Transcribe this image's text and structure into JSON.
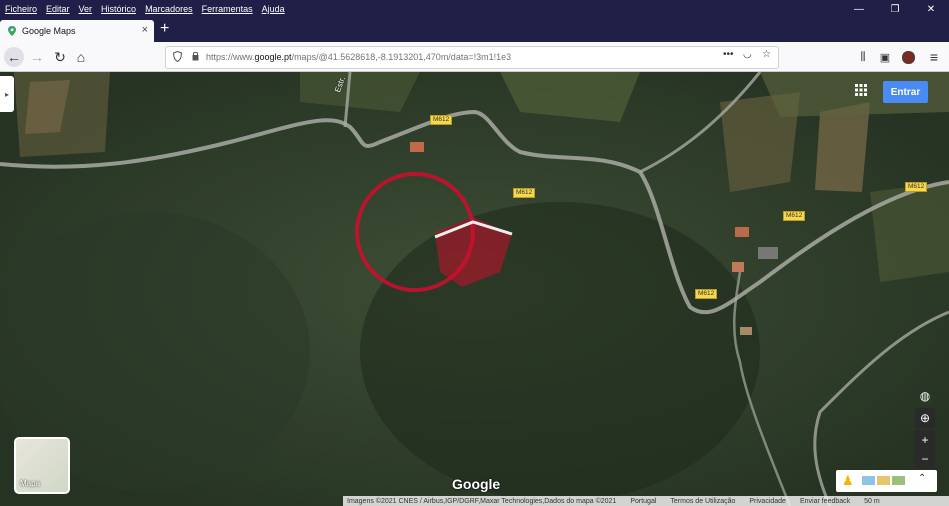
{
  "menu": {
    "items": [
      "Ficheiro",
      "Editar",
      "Ver",
      "Histórico",
      "Marcadores",
      "Ferramentas",
      "Ajuda"
    ]
  },
  "tab": {
    "title": "Google Maps",
    "close": "×",
    "new_tab": "+"
  },
  "url": {
    "prefix": "https://www.",
    "host": "google.pt",
    "path": "/maps/@41.5628618,-8.1913201,470m/data=!3m1!1e3"
  },
  "map": {
    "road_labels": [
      "M612",
      "M612",
      "M612",
      "M612",
      "M612"
    ],
    "street_label": "Estr.",
    "sign_in": "Entrar",
    "layer_thumb_label": "Mapa",
    "logo": "Google",
    "zoom_in": "+",
    "zoom_out": "−",
    "footer": {
      "imagery": "Imagens ©2021 CNES / Airbus,IGP/DGRF,Maxar Technologies,Dados do mapa ©2021",
      "country": "Portugal",
      "terms": "Termos de Utilização",
      "privacy": "Privacidade",
      "feedback": "Enviar feedback",
      "scale": "50 m"
    }
  },
  "colors": {
    "menubar": "#1f1f47",
    "accent": "#4a8af4",
    "road_sign": "#f7d84a",
    "marker_red": "#c8102e"
  },
  "icons": [
    "google-maps-favicon",
    "back-arrow-icon",
    "forward-arrow-icon",
    "reload-icon",
    "home-icon",
    "shield-icon",
    "lock-icon",
    "more-icon",
    "pocket-icon",
    "bookmark-star-icon",
    "library-icon",
    "sidebar-icon",
    "account-icon",
    "menu-icon",
    "apps-grid-icon",
    "globe-icon",
    "location-icon",
    "pegman-icon",
    "expand-icon"
  ]
}
